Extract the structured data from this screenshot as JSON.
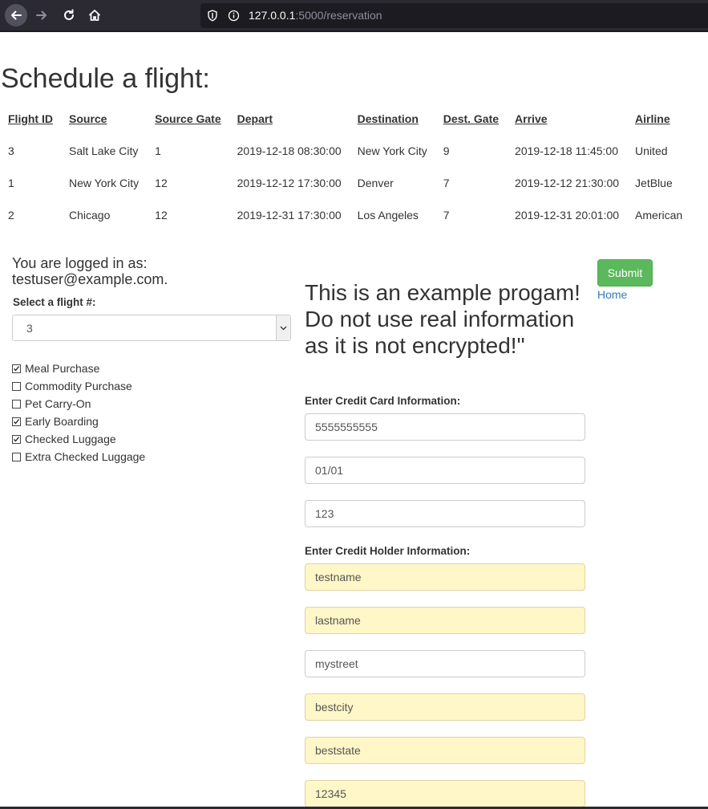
{
  "browser": {
    "url_host": "127.0.0.1",
    "url_path": ":5000/reservation"
  },
  "page": {
    "title": "Schedule a flight:"
  },
  "flights_table": {
    "headers": [
      "Flight ID",
      "Source",
      "Source Gate",
      "Depart",
      "Destination",
      "Dest. Gate",
      "Arrive",
      "Airline"
    ],
    "rows": [
      [
        "3",
        "Salt Lake City",
        "1",
        "2019-12-18 08:30:00",
        "New York City",
        "9",
        "2019-12-18 11:45:00",
        "United"
      ],
      [
        "1",
        "New York City",
        "12",
        "2019-12-12 17:30:00",
        "Denver",
        "7",
        "2019-12-12 21:30:00",
        "JetBlue"
      ],
      [
        "2",
        "Chicago",
        "12",
        "2019-12-31 17:30:00",
        "Los Angeles",
        "7",
        "2019-12-31 20:01:00",
        "American"
      ]
    ]
  },
  "user": {
    "logged_in_label": "You are logged in as:",
    "email": "testuser@example.com."
  },
  "flight_select": {
    "label": "Select a flight #:",
    "value": "3"
  },
  "addons": [
    {
      "label": "Meal Purchase",
      "checked": true
    },
    {
      "label": "Commodity Purchase",
      "checked": false
    },
    {
      "label": "Pet Carry-On",
      "checked": false
    },
    {
      "label": "Early Boarding",
      "checked": true
    },
    {
      "label": "Checked Luggage",
      "checked": true
    },
    {
      "label": "Extra Checked Luggage",
      "checked": false
    }
  ],
  "warning": "This is an example progam! Do not use real information as it is not encrypted!\"",
  "credit_card": {
    "label": "Enter Credit Card Information:",
    "number": "5555555555",
    "expiry": "01/01",
    "cvv": "123"
  },
  "holder": {
    "label": "Enter Credit Holder Information:",
    "first_name": "testname",
    "last_name": "lastname",
    "street": "mystreet",
    "city": "bestcity",
    "state": "beststate",
    "zip": "12345"
  },
  "actions": {
    "submit_label": "Submit",
    "home_label": "Home"
  },
  "colors": {
    "submit": "#5cb85c",
    "link": "#337ab7",
    "autofill": "#fff7c8"
  }
}
